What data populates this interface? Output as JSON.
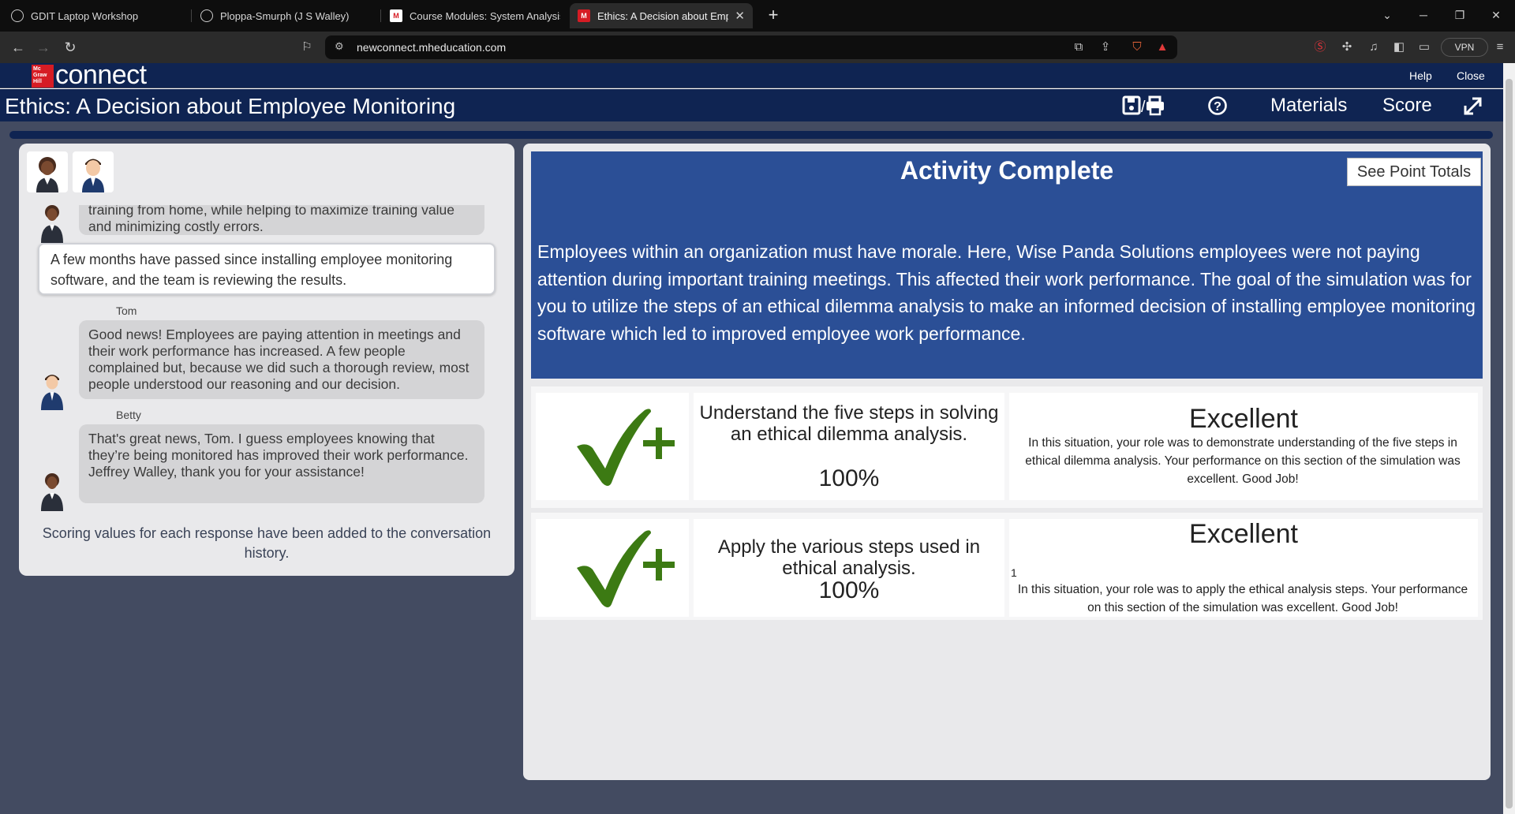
{
  "browser": {
    "tabs": [
      {
        "label": "GDIT Laptop Workshop",
        "icon": "webpage-icon",
        "active": false
      },
      {
        "label": "Ploppa-Smurph (J S Walley)",
        "icon": "webpage-icon",
        "active": false
      },
      {
        "label": "Course Modules: System Analysis an",
        "icon": "mcgraw-hill-icon",
        "active": false
      },
      {
        "label": "Ethics: A Decision about Employ",
        "icon": "mcgraw-hill-icon",
        "active": true
      }
    ],
    "new_tab": "+",
    "url": "newconnect.mheducation.com",
    "vpn_label": "VPN"
  },
  "app": {
    "logo_lines": [
      "Mc",
      "Graw",
      "Hill"
    ],
    "brand": "connect",
    "help_link": "Help",
    "close_link": "Close",
    "title": "Ethics: A Decision about Employee Monitoring",
    "materials_label": "Materials",
    "score_label": "Score"
  },
  "chat": {
    "messages": [
      {
        "type": "bubble",
        "speaker": "",
        "text": "training from home, while helping to maximize training value and minimizing costly errors."
      },
      {
        "type": "narration",
        "text": "A few months have passed since installing employee monitoring software, and the team is reviewing the results."
      },
      {
        "type": "bubble",
        "speaker": "Tom",
        "text": "Good news! Employees are paying attention in meetings and their work performance has increased. A few people complained but, because we did such a thorough review, most people understood our reasoning and our decision."
      },
      {
        "type": "bubble",
        "speaker": "Betty",
        "text": "That's great news, Tom. I guess employees knowing that they’re being monitored has improved their work performance. Jeffrey Walley, thank you for your assistance!"
      }
    ],
    "scoring_note": "Scoring values for each response have been added to the conversation history."
  },
  "results": {
    "title": "Activity Complete",
    "point_totals_button": "See Point Totals",
    "summary": "Employees within an organization must have morale. Here, Wise Panda Solutions employees were not paying attention during important training meetings. This affected their work performance. The goal of the simulation was for you to utilize the steps of an ethical dilemma analysis to make an informed decision of installing employee monitoring software which led to improved employee work performance.",
    "objectives": [
      {
        "icon": "check-plus-icon",
        "objective": "Understand the five steps in solving an ethical dilemma analysis.",
        "percent": "100%",
        "rating": "Excellent",
        "marker": "",
        "feedback": "In this situation, your role was to demonstrate understanding of the five steps in ethical dilemma analysis.  Your performance on this section of the simulation was excellent. Good Job!"
      },
      {
        "icon": "check-plus-icon",
        "objective": "Apply the various steps used in ethical analysis.",
        "percent": "100%",
        "rating": "Excellent",
        "marker": "1",
        "feedback": "In this situation, your role was to apply the ethical analysis steps. Your performance on this section of the simulation was excellent. Good Job!"
      }
    ]
  },
  "colors": {
    "brand_navy": "#0f2452",
    "results_blue": "#2b4f96",
    "check_green": "#3c7a13",
    "page_background": "#434b61",
    "mh_red": "#d61c24"
  }
}
